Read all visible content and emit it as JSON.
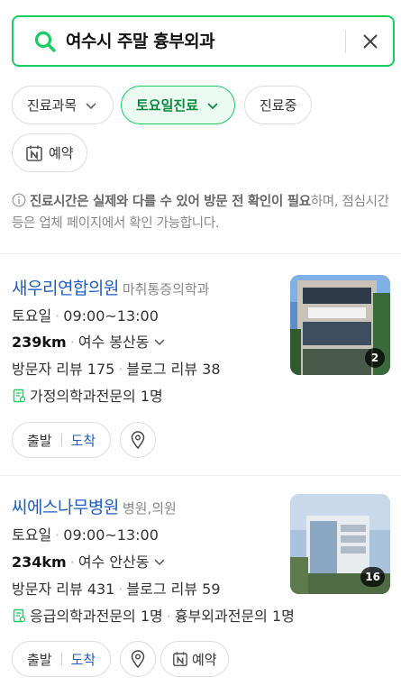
{
  "search": {
    "query": "여수시 주말 흉부외과"
  },
  "filters": {
    "chips": [
      {
        "label": "진료과목"
      },
      {
        "label": "토요일진료"
      },
      {
        "label": "진료중"
      },
      {
        "label": "예약"
      }
    ]
  },
  "notice": {
    "bold": "진료시간은 실제와 다를 수 있어 방문 전 확인이 필요",
    "rest": "하며, 점심시간 등은 업체 페이지에서 확인 가능합니다."
  },
  "places": [
    {
      "name": "새우리연합의원",
      "category": "마취통증의학과",
      "day": "토요일",
      "hours": "09:00~13:00",
      "distance": "239km",
      "area": "여수 봉산동",
      "visitor_reviews": "방문자 리뷰 175",
      "blog_reviews": "블로그 리뷰 38",
      "specialists": [
        "가정의학과전문의 1명"
      ],
      "photo_count": "2",
      "route_start": "출발",
      "route_arrive": "도착"
    },
    {
      "name": "씨에스나무병원",
      "category": "병원,의원",
      "day": "토요일",
      "hours": "09:00~13:00",
      "distance": "234km",
      "area": "여수 안산동",
      "visitor_reviews": "방문자 리뷰 431",
      "blog_reviews": "블로그 리뷰 59",
      "specialists": [
        "응급의학과전문의 1명",
        "흉부외과전문의 1명"
      ],
      "photo_count": "16",
      "route_start": "출발",
      "route_arrive": "도착",
      "reserve_label": "예약"
    }
  ],
  "colors": {
    "accent_green": "#19ce60",
    "link_blue": "#1f5ec1"
  }
}
